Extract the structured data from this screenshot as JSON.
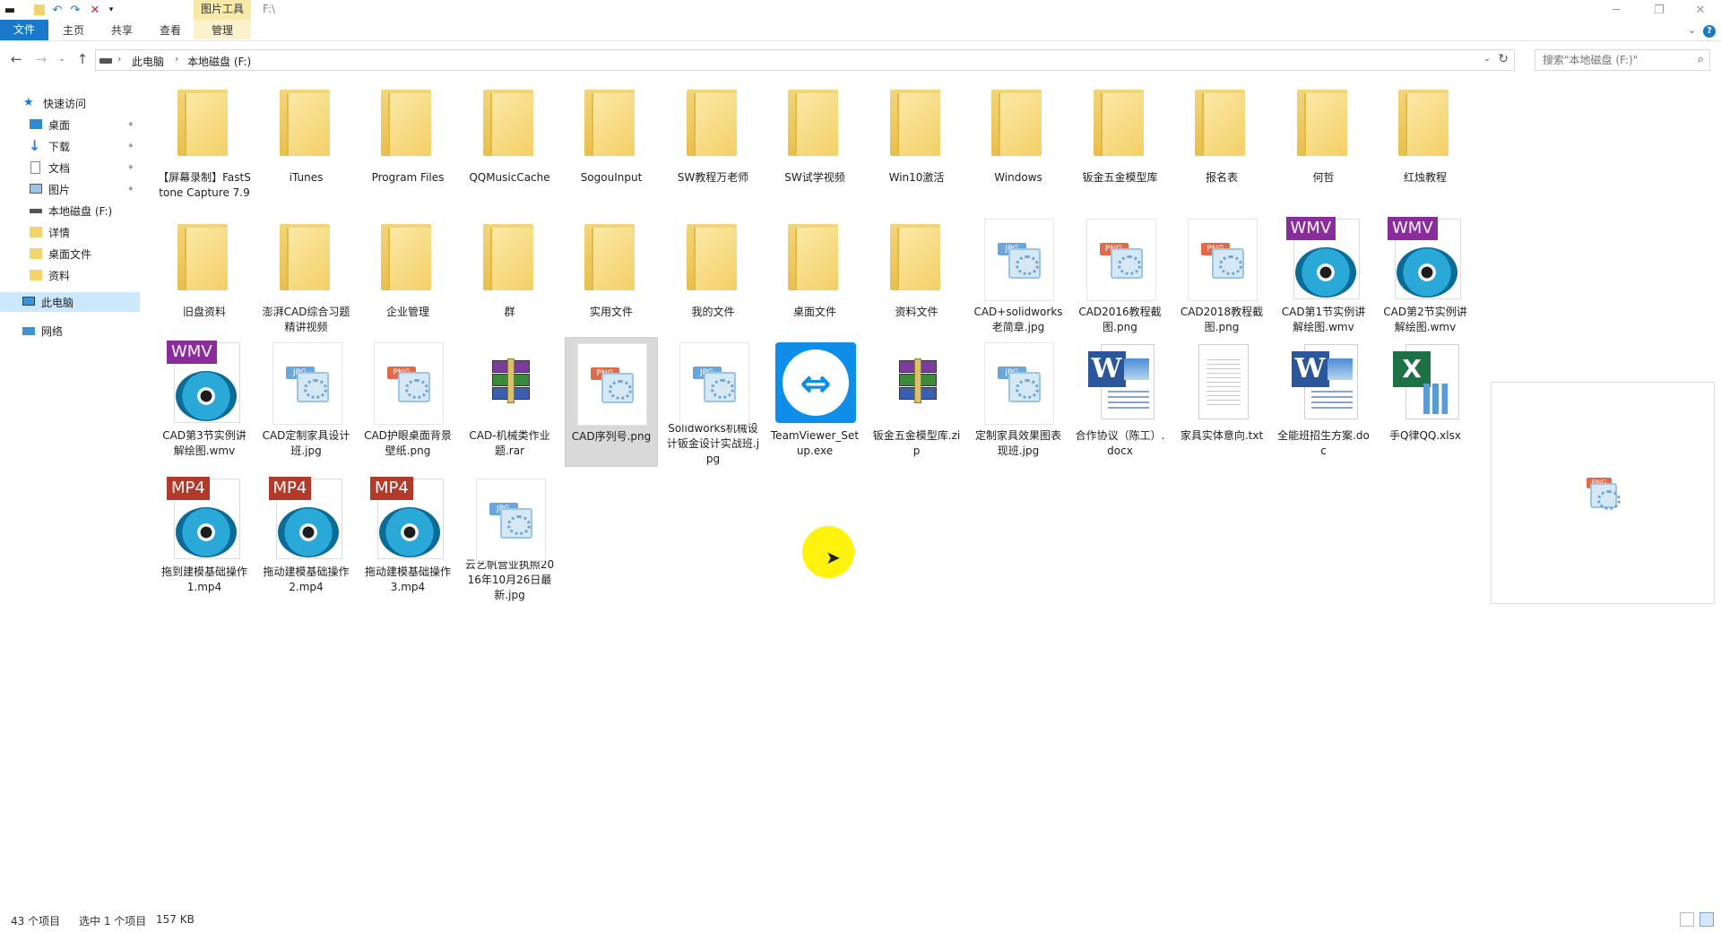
{
  "window": {
    "title": "F:\\",
    "context_tab": "图片工具",
    "controls": {
      "minimize": "─",
      "restore": "❐",
      "close": "✕"
    }
  },
  "ribbon": {
    "tabs": [
      "文件",
      "主页",
      "共享",
      "查看",
      "管理"
    ]
  },
  "address": {
    "crumbs": [
      "此电脑",
      "本地磁盘 (F:)"
    ],
    "search_placeholder": "搜索\"本地磁盘 (F:)\""
  },
  "sidebar": {
    "quick_access": "快速访问",
    "items": [
      {
        "label": "桌面",
        "icon": "desktop-icon",
        "pinned": true
      },
      {
        "label": "下载",
        "icon": "download-icon",
        "pinned": true
      },
      {
        "label": "文档",
        "icon": "document-icon",
        "pinned": true
      },
      {
        "label": "图片",
        "icon": "pictures-icon",
        "pinned": true
      },
      {
        "label": "本地磁盘 (F:)",
        "icon": "drive-icon",
        "pinned": false
      },
      {
        "label": "详情",
        "icon": "folder-icon",
        "pinned": false
      },
      {
        "label": "桌面文件",
        "icon": "folder-icon",
        "pinned": false
      },
      {
        "label": "资料",
        "icon": "folder-icon",
        "pinned": false
      }
    ],
    "this_pc": "此电脑",
    "network": "网络"
  },
  "files": [
    {
      "name": "【屏幕录制】FastStone Capture 7.9",
      "type": "folder"
    },
    {
      "name": "iTunes",
      "type": "folder"
    },
    {
      "name": "Program Files",
      "type": "folder"
    },
    {
      "name": "QQMusicCache",
      "type": "folder"
    },
    {
      "name": "SogouInput",
      "type": "folder"
    },
    {
      "name": "SW教程万老师",
      "type": "folder"
    },
    {
      "name": "SW试学视频",
      "type": "folder"
    },
    {
      "name": "Win10激活",
      "type": "folder"
    },
    {
      "name": "Windows",
      "type": "folder"
    },
    {
      "name": "钣金五金模型库",
      "type": "folder"
    },
    {
      "name": "报名表",
      "type": "folder"
    },
    {
      "name": "何哲",
      "type": "folder"
    },
    {
      "name": "红烛教程",
      "type": "folder"
    },
    {
      "name": "旧盘资料",
      "type": "folder"
    },
    {
      "name": "澎湃CAD综合习题精讲视频",
      "type": "folder"
    },
    {
      "name": "企业管理",
      "type": "folder"
    },
    {
      "name": "群",
      "type": "folder"
    },
    {
      "name": "实用文件",
      "type": "folder"
    },
    {
      "name": "我的文件",
      "type": "folder"
    },
    {
      "name": "桌面文件",
      "type": "folder"
    },
    {
      "name": "资料文件",
      "type": "folder"
    },
    {
      "name": "CAD+solidworks老简章.jpg",
      "type": "jpg"
    },
    {
      "name": "CAD2016教程截图.png",
      "type": "png"
    },
    {
      "name": "CAD2018教程截图.png",
      "type": "png"
    },
    {
      "name": "CAD第1节实例讲解绘图.wmv",
      "type": "wmv"
    },
    {
      "name": "CAD第2节实例讲解绘图.wmv",
      "type": "wmv"
    },
    {
      "name": "CAD第3节实例讲解绘图.wmv",
      "type": "wmv"
    },
    {
      "name": "CAD定制家具设计班.jpg",
      "type": "jpg"
    },
    {
      "name": "CAD护眼桌面背景壁纸.png",
      "type": "png"
    },
    {
      "name": "CAD-机械类作业题.rar",
      "type": "rar"
    },
    {
      "name": "CAD序列号.png",
      "type": "png",
      "selected": true
    },
    {
      "name": "Solidworks机械设计钣金设计实战班.jpg",
      "type": "jpg"
    },
    {
      "name": "TeamViewer_Setup.exe",
      "type": "exe"
    },
    {
      "name": "钣金五金模型库.zip",
      "type": "rar"
    },
    {
      "name": "定制家具效果图表现班.jpg",
      "type": "jpg"
    },
    {
      "name": "合作协议（陈工）.docx",
      "type": "docx"
    },
    {
      "name": "家具实体意向.txt",
      "type": "txt"
    },
    {
      "name": "全能班招生方案.doc",
      "type": "doc"
    },
    {
      "name": "手Q律QQ.xlsx",
      "type": "xlsx"
    },
    {
      "name": "拖到建模基础操作1.mp4",
      "type": "mp4"
    },
    {
      "name": "拖动建模基础操作2.mp4",
      "type": "mp4"
    },
    {
      "name": "拖动建模基础操作3.mp4",
      "type": "mp4"
    },
    {
      "name": "云艺帆营业执照2016年10月26日最新.jpg",
      "type": "jpg"
    }
  ],
  "badges": {
    "png": "PNG",
    "jpg": "JPG",
    "wmv": "WMV",
    "mp4": "MP4"
  },
  "colors": {
    "png_tag": "#e06b4b",
    "jpg_tag": "#6aa6dc",
    "wmv_badge": "#8b2c9c",
    "mp4_badge": "#b23a2a",
    "accent": "#1979ca",
    "word": "#2b579a"
  },
  "status": {
    "count": "43 个项目",
    "selection": "选中 1 个项目",
    "size": "157 KB"
  }
}
